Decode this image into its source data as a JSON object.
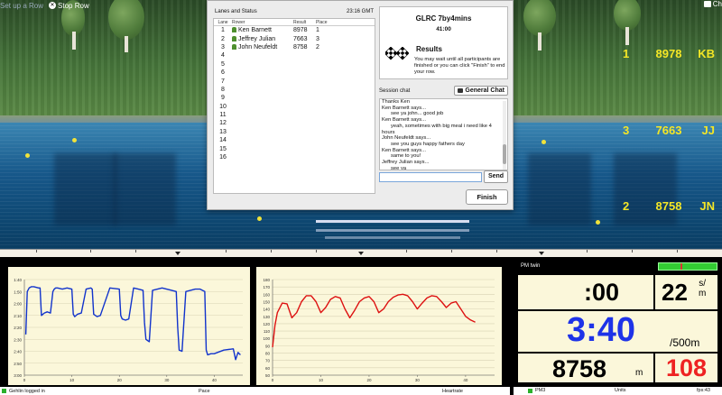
{
  "topbar": {
    "setup_label": "Set up a Row",
    "stop_label": "Stop Row",
    "chat_label": "Ch"
  },
  "lane_overlay": [
    {
      "lane": "1",
      "result": "8978",
      "initials": "KB"
    },
    {
      "lane": "3",
      "result": "7663",
      "initials": "JJ"
    },
    {
      "lane": "2",
      "result": "8758",
      "initials": "JN"
    }
  ],
  "race_window": {
    "lanes_title": "Lanes and Status",
    "clock": "23:16 GMT",
    "columns": [
      "Lane",
      "Rower",
      "Result",
      "Place"
    ],
    "lanes": [
      {
        "lane": "1",
        "rower": "Ken Barnett",
        "result": "8978",
        "place": "1",
        "pin": true
      },
      {
        "lane": "2",
        "rower": "Jeffrey Julian",
        "result": "7663",
        "place": "3",
        "pin": true
      },
      {
        "lane": "3",
        "rower": "John Neufeldt",
        "result": "8758",
        "place": "2",
        "pin": true
      },
      {
        "lane": "4"
      },
      {
        "lane": "5"
      },
      {
        "lane": "6"
      },
      {
        "lane": "7"
      },
      {
        "lane": "8"
      },
      {
        "lane": "9"
      },
      {
        "lane": "10"
      },
      {
        "lane": "11"
      },
      {
        "lane": "12"
      },
      {
        "lane": "13"
      },
      {
        "lane": "14"
      },
      {
        "lane": "15"
      },
      {
        "lane": "16"
      }
    ],
    "info": {
      "title": "GLRC 7by4mins",
      "time": "41:00",
      "results_title": "Results",
      "results_text": "You may wait until all participants are finished or you can click \"Finish\" to end your row."
    },
    "chat": {
      "label": "Session chat",
      "general_button": "General Chat",
      "lines": [
        {
          "text": "Thanks Ken",
          "indent": false
        },
        {
          "text": "Ken Barnett says...",
          "indent": false
        },
        {
          "text": "see ya john... good job",
          "indent": true
        },
        {
          "text": "Ken Barnett says...",
          "indent": false
        },
        {
          "text": "yeah, sometimes with big meal i need like 4",
          "indent": true
        },
        {
          "text": "hours",
          "indent": false
        },
        {
          "text": "John Neufeldt says...",
          "indent": false
        },
        {
          "text": "see you guys happy fathers day",
          "indent": true
        },
        {
          "text": "Ken Barnett says...",
          "indent": false
        },
        {
          "text": "same to you!",
          "indent": true
        },
        {
          "text": "Jeffrey Julian says...",
          "indent": false
        },
        {
          "text": "see ya",
          "indent": true
        }
      ],
      "input_value": "",
      "send_label": "Send"
    },
    "finish_label": "Finish"
  },
  "charts_status": {
    "logged_in": "Gehlin logged in",
    "pace_label": "Pace",
    "heartrate_label": "Heartrate"
  },
  "chart_data": [
    {
      "type": "line",
      "title": "",
      "xlabel": "Pace",
      "ylabel": "",
      "x_ticks": [
        "0",
        "10",
        "20",
        "30",
        "40"
      ],
      "y_ticks": [
        "1:40",
        "1:50",
        "2:00",
        "2:10",
        "2:20",
        "2:30",
        "2:40",
        "2:50",
        "3:00"
      ],
      "ylim_seconds": [
        100,
        180
      ],
      "xlim": [
        0,
        46
      ],
      "series": [
        {
          "color": "#1133cc",
          "x": [
            0.3,
            0.6,
            1,
            1.5,
            2,
            3,
            3.3,
            3.6,
            4.2,
            4.8,
            5.5,
            6,
            6.3,
            6.6,
            7,
            8,
            9,
            10,
            10.3,
            10.6,
            11.2,
            12,
            13,
            14,
            14.3,
            14.6,
            15.3,
            16,
            18,
            20,
            20.3,
            20.6,
            21.3,
            22,
            23,
            24,
            25,
            25.3,
            25.6,
            26.3,
            27,
            29,
            31,
            32,
            32.3,
            32.6,
            33.2,
            34,
            36,
            37,
            38,
            38.3,
            38.6,
            39.3,
            40,
            42,
            44,
            44.5,
            45,
            45.5
          ],
          "values": [
            146,
            110,
            107,
            106,
            106,
            107,
            107,
            130,
            128,
            127,
            128,
            110,
            108,
            107,
            107,
            108,
            107,
            108,
            129,
            131,
            129,
            128,
            108,
            107,
            108,
            129,
            131,
            130,
            107,
            108,
            130,
            133,
            134,
            133,
            107,
            108,
            109,
            136,
            150,
            152,
            109,
            107,
            109,
            110,
            140,
            159,
            160,
            110,
            108,
            108,
            110,
            159,
            163,
            162,
            162,
            159,
            158,
            167,
            161,
            163
          ]
        }
      ]
    },
    {
      "type": "line",
      "title": "",
      "xlabel": "Heartrate",
      "ylabel": "",
      "x_ticks": [
        "0",
        "10",
        "20",
        "30",
        "40"
      ],
      "y_ticks": [
        "50",
        "60",
        "70",
        "80",
        "90",
        "100",
        "110",
        "120",
        "130",
        "140",
        "150",
        "160",
        "170",
        "180"
      ],
      "ylim": [
        50,
        180
      ],
      "xlim": [
        0,
        46
      ],
      "series": [
        {
          "color": "#dd1111",
          "x": [
            0,
            0.5,
            1,
            2,
            3,
            4,
            5,
            6,
            7,
            8,
            9,
            10,
            11,
            12,
            13,
            14,
            15,
            16,
            17,
            18,
            19,
            20,
            21,
            22,
            23,
            24,
            25,
            26,
            27,
            28,
            29,
            30,
            31,
            32,
            33,
            34,
            35,
            36,
            37,
            38,
            39,
            40,
            41,
            42
          ],
          "values": [
            88,
            118,
            135,
            148,
            147,
            128,
            135,
            150,
            158,
            158,
            150,
            135,
            142,
            153,
            157,
            155,
            140,
            128,
            138,
            150,
            155,
            157,
            150,
            135,
            140,
            150,
            156,
            159,
            160,
            158,
            150,
            140,
            148,
            155,
            158,
            157,
            150,
            142,
            148,
            150,
            140,
            130,
            125,
            122
          ]
        }
      ]
    }
  ],
  "pm": {
    "title": "PM twin",
    "time": ":00",
    "spm_value": "22",
    "spm_unit_top": "s/",
    "spm_unit_bottom": "m",
    "pace": "3:40",
    "pace_unit": "/500m",
    "meters": "8758",
    "meters_unit": "m",
    "heartrate": "108",
    "battery_level": 1.0,
    "footer_pm": "PM3",
    "footer_units": "Units",
    "footer_fps": "fps:43"
  }
}
